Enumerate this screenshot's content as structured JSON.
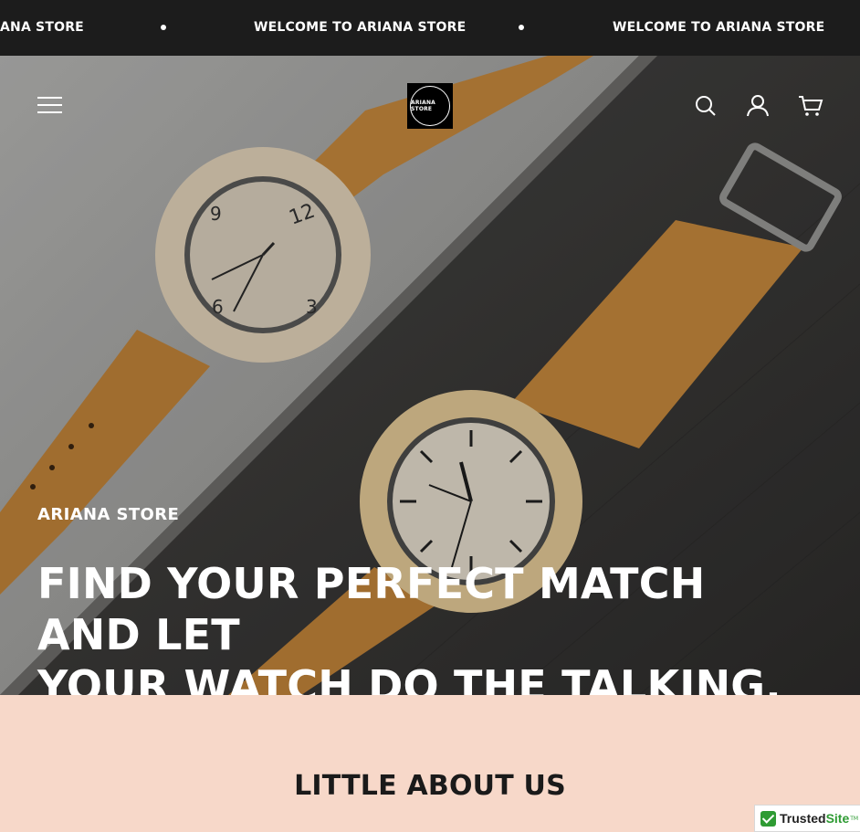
{
  "announcement": {
    "messages": [
      "ANA STORE",
      "WELCOME TO ARIANA STORE",
      "WELCOME TO ARIANA STORE"
    ]
  },
  "header": {
    "logo_text": "ARIANA STORE",
    "icons": [
      "menu-icon",
      "search-icon",
      "account-icon",
      "cart-icon"
    ]
  },
  "hero": {
    "eyebrow": "ARIANA STORE",
    "headline_line1": "FIND YOUR PERFECT MATCH AND LET",
    "headline_line2": "YOUR WATCH DO THE TALKING."
  },
  "about": {
    "title": "LITTLE ABOUT US"
  },
  "badge": {
    "trusted_label": "Trusted",
    "site_label": "Site",
    "tm": "TM"
  },
  "colors": {
    "announcement_bg": "#1c1c1c",
    "about_bg": "#f7d8c9",
    "strap": "#c98a3d",
    "trusted_green": "#2e9b33"
  }
}
